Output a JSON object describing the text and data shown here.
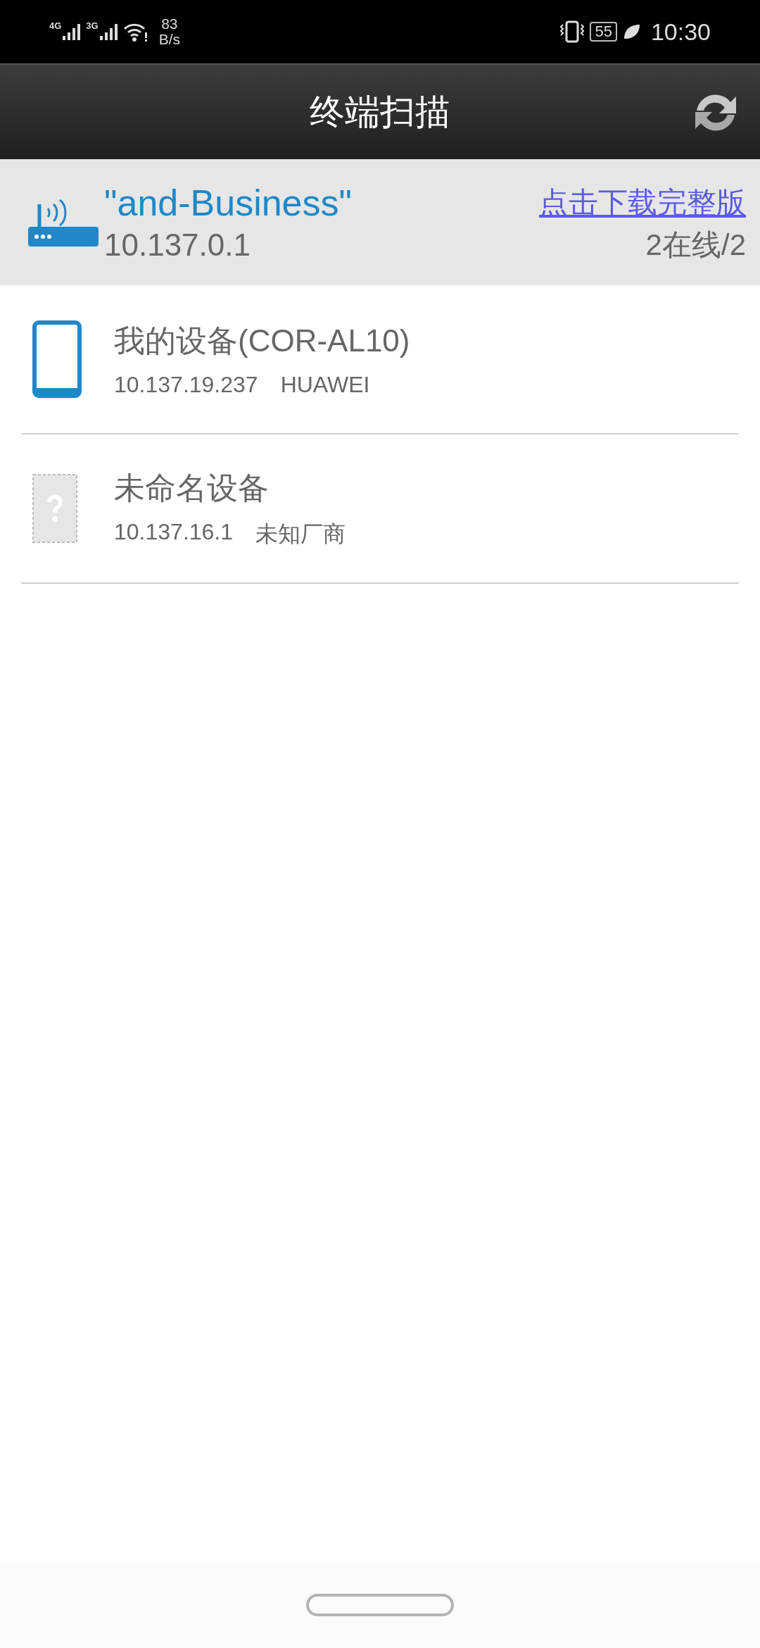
{
  "status_bar": {
    "signal_1": "4G",
    "signal_2": "3G",
    "speed_value": "83",
    "speed_unit": "B/s",
    "battery": "55",
    "time": "10:30"
  },
  "header": {
    "title": "终端扫描"
  },
  "network": {
    "ssid": "\"and-Business\"",
    "ip": "10.137.0.1",
    "download_link": "点击下载完整版",
    "online_count": "2在线/2"
  },
  "devices": [
    {
      "kind": "phone",
      "name": "我的设备(COR-AL10)",
      "ip": "10.137.19.237",
      "vendor": "HUAWEI"
    },
    {
      "kind": "unknown",
      "name": "未命名设备",
      "ip": "10.137.16.1",
      "vendor": "未知厂商"
    }
  ]
}
